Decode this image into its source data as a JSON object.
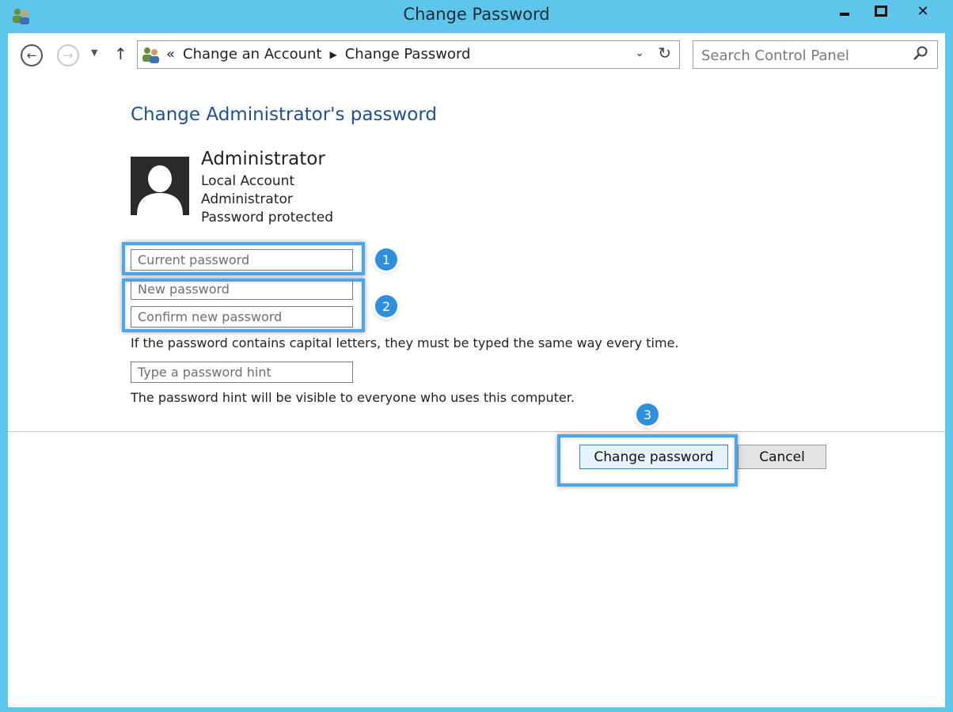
{
  "window": {
    "title": "Change Password"
  },
  "nav": {
    "breadcrumb_overflow": "«",
    "breadcrumbs": [
      "Change an Account",
      "Change Password"
    ],
    "search_placeholder": "Search Control Panel"
  },
  "content": {
    "heading": "Change Administrator's password",
    "account": {
      "name": "Administrator",
      "type": "Local Account",
      "role": "Administrator",
      "status": "Password protected"
    },
    "fields": {
      "current_password_placeholder": "Current password",
      "new_password_placeholder": "New password",
      "confirm_password_placeholder": "Confirm new password",
      "hint_placeholder": "Type a password hint"
    },
    "notes": {
      "capitals": "If the password contains capital letters, they must be typed the same way every time.",
      "hint": "The password hint will be visible to everyone who uses this computer."
    },
    "buttons": {
      "change": "Change password",
      "cancel": "Cancel"
    }
  },
  "annotations": {
    "step1": "1",
    "step2": "2",
    "step3": "3",
    "highlight_color": "#4aa7e9",
    "badge_color": "#2d8fe0"
  },
  "icons": {
    "app": "users-icon",
    "back": "back-arrow-icon",
    "forward": "forward-arrow-icon",
    "recent": "chevron-down-icon",
    "up": "up-arrow-icon",
    "refresh": "refresh-icon",
    "search": "search-icon",
    "avatar": "user-silhouette-icon"
  }
}
